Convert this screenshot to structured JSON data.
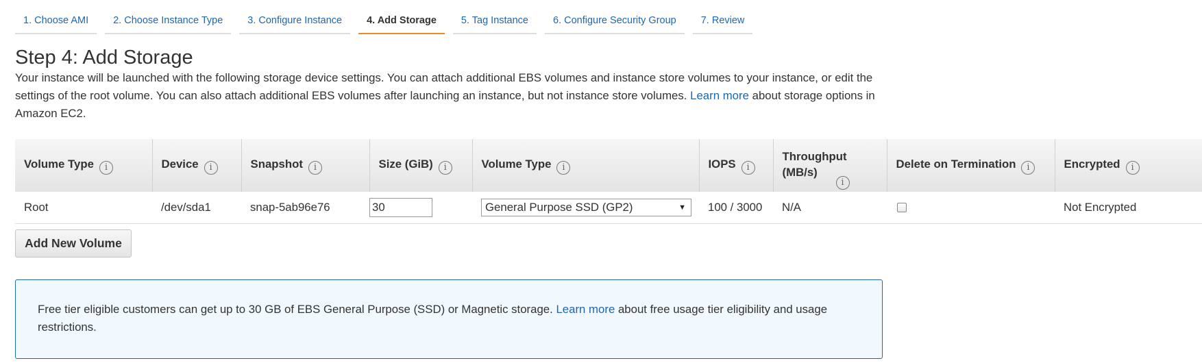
{
  "wizard": {
    "steps": [
      {
        "label": "1. Choose AMI"
      },
      {
        "label": "2. Choose Instance Type"
      },
      {
        "label": "3. Configure Instance"
      },
      {
        "label": "4. Add Storage"
      },
      {
        "label": "5. Tag Instance"
      },
      {
        "label": "6. Configure Security Group"
      },
      {
        "label": "7. Review"
      }
    ],
    "active_step": 4
  },
  "page": {
    "title": "Step 4: Add Storage",
    "description_before_link": "Your instance will be launched with the following storage device settings. You can attach additional EBS volumes and instance store volumes to your instance, or edit the settings of the root volume. You can also attach additional EBS volumes after launching an instance, but not instance store volumes.",
    "learn_more": "Learn more",
    "description_after_link": "about storage options in Amazon EC2."
  },
  "table": {
    "headers": {
      "volume_type": "Volume Type",
      "device": "Device",
      "snapshot": "Snapshot",
      "size": "Size (GiB)",
      "ebs_volume_type": "Volume Type",
      "iops": "IOPS",
      "throughput": "Throughput (MB/s)",
      "delete_on_termination": "Delete on Termination",
      "encrypted": "Encrypted"
    },
    "info_glyph": "i",
    "rows": [
      {
        "volume_type": "Root",
        "device": "/dev/sda1",
        "snapshot": "snap-5ab96e76",
        "size": "30",
        "ebs_volume_type": "General Purpose SSD (GP2)",
        "iops": "100 / 3000",
        "throughput": "N/A",
        "delete_on_termination": false,
        "encrypted": "Not Encrypted"
      }
    ]
  },
  "actions": {
    "add_volume_label": "Add New Volume"
  },
  "notice": {
    "text_before_link": "Free tier eligible customers can get up to 30 GB of EBS General Purpose (SSD) or Magnetic storage.",
    "learn_more": "Learn more",
    "text_after_link": "about free usage tier eligibility and usage restrictions."
  },
  "colors": {
    "link": "#1f66b0",
    "active_tab_underline": "#ec8c1f",
    "notice_border": "#1f66b0",
    "notice_bg": "#f1f8fe"
  }
}
